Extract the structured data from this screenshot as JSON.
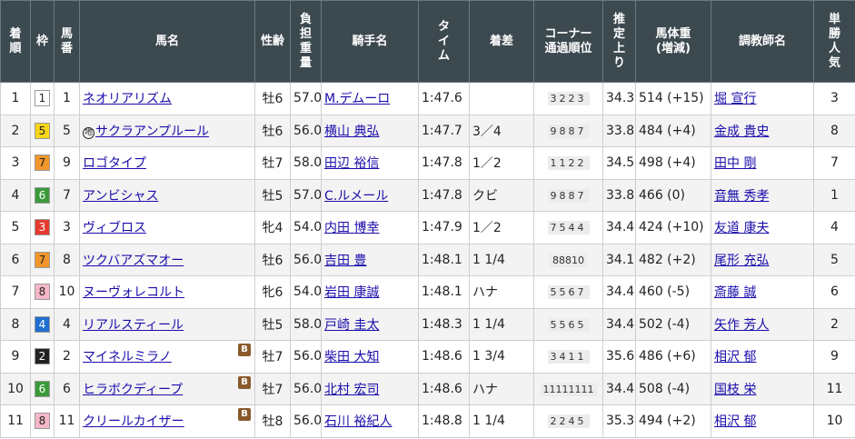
{
  "headers": {
    "rank": "着順",
    "waku": "枠",
    "umaban": "馬番",
    "horse": "馬名",
    "sexage": "性齢",
    "weight": "負担重量",
    "jockey": "騎手名",
    "time": "タイム",
    "margin": "着差",
    "corner": "コーナー通過順位",
    "last3f": "推定上り",
    "bodyweight_line1": "馬体重",
    "bodyweight_line2": "(増減)",
    "trainer": "調教師名",
    "popularity": "単勝人気"
  },
  "waku_colors": {
    "1": {
      "bg": "#ffffff",
      "fg": "#222222"
    },
    "2": {
      "bg": "#222222",
      "fg": "#ffffff"
    },
    "3": {
      "bg": "#e63a2e",
      "fg": "#ffffff"
    },
    "4": {
      "bg": "#1f6fd0",
      "fg": "#ffffff"
    },
    "5": {
      "bg": "#f7d51b",
      "fg": "#222222"
    },
    "6": {
      "bg": "#3a9a3a",
      "fg": "#ffffff"
    },
    "7": {
      "bg": "#f2962c",
      "fg": "#222222"
    },
    "8": {
      "bg": "#f6b8c8",
      "fg": "#222222"
    }
  },
  "rows": [
    {
      "rank": "1",
      "waku": "1",
      "umaban": "1",
      "chiho": "",
      "horse": "ネオリアリズム",
      "blinker": "",
      "sexage": "牡6",
      "weight": "57.0",
      "jockey": "M.デムーロ",
      "time": "1:47.6",
      "margin": "",
      "corner": "3223",
      "last3f": "34.3",
      "bodyweight": "514 (+15)",
      "trainer": "堀 宣行",
      "popularity": "3"
    },
    {
      "rank": "2",
      "waku": "5",
      "umaban": "5",
      "chiho": "地",
      "horse": "サクラアンプルール",
      "blinker": "",
      "sexage": "牡6",
      "weight": "56.0",
      "jockey": "横山 典弘",
      "time": "1:47.7",
      "margin": "3／4",
      "corner": "9887",
      "last3f": "33.8",
      "bodyweight": "484 (+4)",
      "trainer": "金成 貴史",
      "popularity": "8"
    },
    {
      "rank": "3",
      "waku": "7",
      "umaban": "9",
      "chiho": "",
      "horse": "ロゴタイプ",
      "blinker": "",
      "sexage": "牡7",
      "weight": "58.0",
      "jockey": "田辺 裕信",
      "time": "1:47.8",
      "margin": "1／2",
      "corner": "1122",
      "last3f": "34.5",
      "bodyweight": "498 (+4)",
      "trainer": "田中 剛",
      "popularity": "7"
    },
    {
      "rank": "4",
      "waku": "6",
      "umaban": "7",
      "chiho": "",
      "horse": "アンビシャス",
      "blinker": "",
      "sexage": "牡5",
      "weight": "57.0",
      "jockey": "C.ルメール",
      "time": "1:47.8",
      "margin": "クビ",
      "corner": "9887",
      "last3f": "33.8",
      "bodyweight": "466 (0)",
      "trainer": "音無 秀孝",
      "popularity": "1"
    },
    {
      "rank": "5",
      "waku": "3",
      "umaban": "3",
      "chiho": "",
      "horse": "ヴィブロス",
      "blinker": "",
      "sexage": "牝4",
      "weight": "54.0",
      "jockey": "内田 博幸",
      "time": "1:47.9",
      "margin": "1／2",
      "corner": "7544",
      "last3f": "34.4",
      "bodyweight": "424 (+10)",
      "trainer": "友道 康夫",
      "popularity": "4"
    },
    {
      "rank": "6",
      "waku": "7",
      "umaban": "8",
      "chiho": "",
      "horse": "ツクバアズマオー",
      "blinker": "",
      "sexage": "牡6",
      "weight": "56.0",
      "jockey": "吉田 豊",
      "time": "1:48.1",
      "margin": "1 1/4",
      "corner": "88810",
      "last3f": "34.1",
      "bodyweight": "482 (+2)",
      "trainer": "尾形 充弘",
      "popularity": "5"
    },
    {
      "rank": "7",
      "waku": "8",
      "umaban": "10",
      "chiho": "",
      "horse": "ヌーヴォレコルト",
      "blinker": "",
      "sexage": "牝6",
      "weight": "54.0",
      "jockey": "岩田 康誠",
      "time": "1:48.1",
      "margin": "ハナ",
      "corner": "5567",
      "last3f": "34.4",
      "bodyweight": "460 (-5)",
      "trainer": "斎藤 誠",
      "popularity": "6"
    },
    {
      "rank": "8",
      "waku": "4",
      "umaban": "4",
      "chiho": "",
      "horse": "リアルスティール",
      "blinker": "",
      "sexage": "牡5",
      "weight": "58.0",
      "jockey": "戸崎 圭太",
      "time": "1:48.3",
      "margin": "1 1/4",
      "corner": "5565",
      "last3f": "34.4",
      "bodyweight": "502 (-4)",
      "trainer": "矢作 芳人",
      "popularity": "2"
    },
    {
      "rank": "9",
      "waku": "2",
      "umaban": "2",
      "chiho": "",
      "horse": "マイネルミラノ",
      "blinker": "B",
      "sexage": "牡7",
      "weight": "56.0",
      "jockey": "柴田 大知",
      "time": "1:48.6",
      "margin": "1 3/4",
      "corner": "3411",
      "last3f": "35.6",
      "bodyweight": "486 (+6)",
      "trainer": "相沢 郁",
      "popularity": "9"
    },
    {
      "rank": "10",
      "waku": "6",
      "umaban": "6",
      "chiho": "",
      "horse": "ヒラボクディープ",
      "blinker": "B",
      "sexage": "牡7",
      "weight": "56.0",
      "jockey": "北村 宏司",
      "time": "1:48.6",
      "margin": "ハナ",
      "corner": "11111111",
      "last3f": "34.4",
      "bodyweight": "508 (-4)",
      "trainer": "国枝 栄",
      "popularity": "11"
    },
    {
      "rank": "11",
      "waku": "8",
      "umaban": "11",
      "chiho": "",
      "horse": "クリールカイザー",
      "blinker": "B",
      "sexage": "牡8",
      "weight": "56.0",
      "jockey": "石川 裕紀人",
      "time": "1:48.8",
      "margin": "1 1/4",
      "corner": "2245",
      "last3f": "35.3",
      "bodyweight": "494 (+2)",
      "trainer": "相沢 郁",
      "popularity": "10"
    }
  ]
}
